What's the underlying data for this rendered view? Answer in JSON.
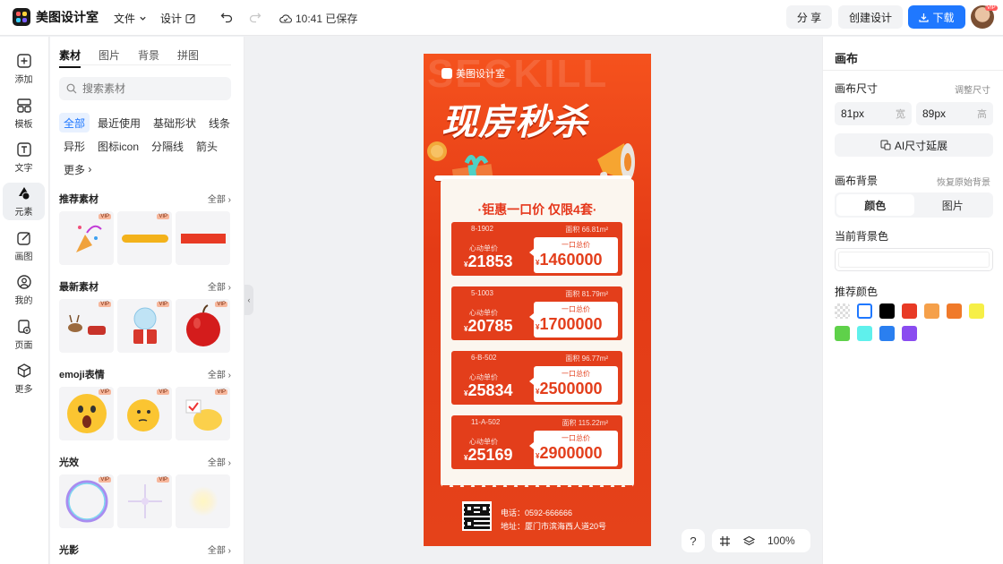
{
  "app": {
    "name": "美图设计室"
  },
  "topbar": {
    "file_label": "文件",
    "design_label": "设计",
    "saved_status": "10:41 已保存",
    "share_label": "分 享",
    "create_label": "创建设计",
    "download_label": "下载",
    "vip_badge": "VIP"
  },
  "rail": [
    {
      "label": "添加",
      "icon": "plus-square-icon"
    },
    {
      "label": "模板",
      "icon": "template-icon"
    },
    {
      "label": "文字",
      "icon": "text-icon"
    },
    {
      "label": "元素",
      "icon": "shapes-icon",
      "active": true
    },
    {
      "label": "画图",
      "icon": "draw-icon"
    },
    {
      "label": "我的",
      "icon": "user-icon"
    },
    {
      "label": "页面",
      "icon": "page-icon"
    },
    {
      "label": "更多",
      "icon": "cube-icon"
    }
  ],
  "panel": {
    "tabs": [
      "素材",
      "图片",
      "背景",
      "拼图"
    ],
    "search_placeholder": "搜索素材",
    "chips": [
      "全部",
      "最近使用",
      "基础形状",
      "线条",
      "异形",
      "图标icon",
      "分隔线",
      "箭头",
      "更多"
    ],
    "sections": [
      {
        "title": "推荐素材",
        "all": "全部"
      },
      {
        "title": "最新素材",
        "all": "全部"
      },
      {
        "title": "emoji表情",
        "all": "全部"
      },
      {
        "title": "光效",
        "all": "全部"
      },
      {
        "title": "光影",
        "all": "全部"
      }
    ]
  },
  "poster": {
    "bg_text": "SECKILL",
    "brand": "美图设计室",
    "title": "现房秒杀",
    "slogan": "·钜惠一口价 仅限4套·",
    "unit_price_label": "心动单价",
    "total_price_label": "一口总价",
    "listings": [
      {
        "unit": "8-1902",
        "area": "面积 66.81m²",
        "unit_price": "21853",
        "total": "1460000"
      },
      {
        "unit": "5-1003",
        "area": "面积 81.79m²",
        "unit_price": "20785",
        "total": "1700000"
      },
      {
        "unit": "6-B-502",
        "area": "面积 96.77m²",
        "unit_price": "25834",
        "total": "2500000"
      },
      {
        "unit": "11-A-502",
        "area": "面积 115.22m²",
        "unit_price": "25169",
        "total": "2900000"
      }
    ],
    "currency": "¥",
    "phone": "电话：0592-666666",
    "address": "地址：厦门市滨海西人道20号"
  },
  "zoom": {
    "help": "?",
    "level": "100%"
  },
  "props": {
    "title": "画布",
    "size_label": "画布尺寸",
    "resize_link": "调整尺寸",
    "width_value": "81px",
    "width_unit": "宽",
    "height_value": "89px",
    "height_unit": "高",
    "ai_button": "AI尺寸延展",
    "bg_label": "画布背景",
    "restore_link": "恢复原始背景",
    "seg_color": "颜色",
    "seg_image": "图片",
    "current_bg_label": "当前背景色",
    "recommended_label": "推荐颜色",
    "swatches": [
      "transparent",
      "#ffffff",
      "#000000",
      "#e83a25",
      "#f5a04a",
      "#f07a2a",
      "#f6ef47",
      "#5fd14a",
      "#5ff0ec",
      "#2a7ff0",
      "#8a4cf0"
    ]
  }
}
